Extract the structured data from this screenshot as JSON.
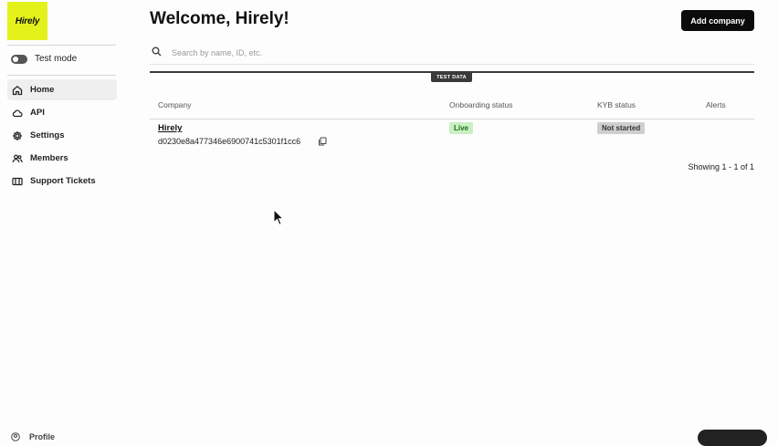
{
  "sidebar": {
    "logo_text": "Hirely",
    "test_mode_label": "Test mode",
    "items": [
      {
        "label": "Home",
        "icon": "home-icon",
        "active": true
      },
      {
        "label": "API",
        "icon": "cloud-icon",
        "active": false
      },
      {
        "label": "Settings",
        "icon": "gear-icon",
        "active": false
      },
      {
        "label": "Members",
        "icon": "users-icon",
        "active": false
      },
      {
        "label": "Support Tickets",
        "icon": "ticket-icon",
        "active": false
      }
    ],
    "profile_label": "Profile"
  },
  "header": {
    "title": "Welcome, Hirely!",
    "add_button_label": "Add company"
  },
  "search": {
    "placeholder": "Search by name, ID, etc.",
    "value": ""
  },
  "test_data_label": "TEST DATA",
  "table": {
    "columns": [
      "Company",
      "Onboarding status",
      "KYB status",
      "Alerts"
    ],
    "rows": [
      {
        "company_name": "Hirely",
        "company_id": "d0230e8a477346e6900741c5301f1cc6",
        "onboarding_status": "Live",
        "kyb_status": "Not started",
        "alerts": ""
      }
    ]
  },
  "pagination_text": "Showing 1 - 1 of 1",
  "colors": {
    "brand": "#e4f21c",
    "primary_button": "#0b0b0b",
    "live_badge": "#c9f0c2",
    "not_started_badge": "#cfcfcf"
  }
}
